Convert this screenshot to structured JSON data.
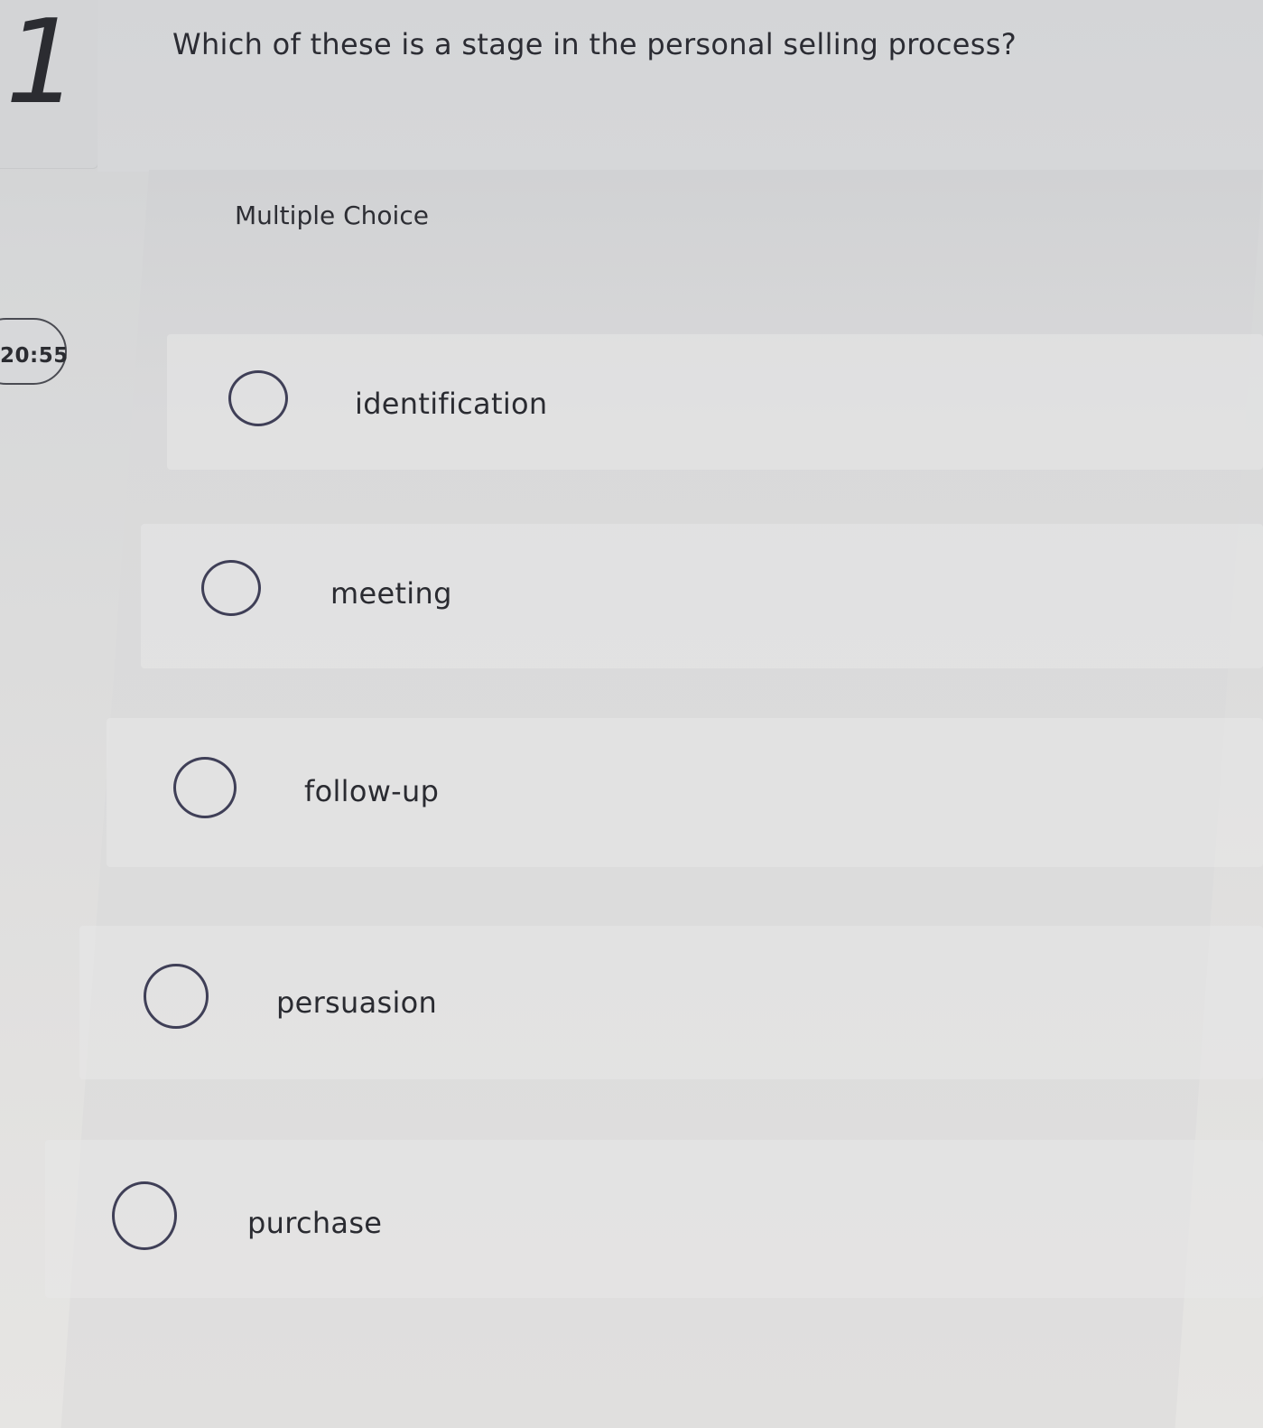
{
  "question": {
    "number": "1",
    "text": "Which of these is a stage in the personal selling process?",
    "type_label": "Multiple Choice"
  },
  "timer": {
    "value": "20:55"
  },
  "choices": [
    {
      "label": "identification",
      "selected": false
    },
    {
      "label": "meeting",
      "selected": false
    },
    {
      "label": "follow-up",
      "selected": false
    },
    {
      "label": "persuasion",
      "selected": false
    },
    {
      "label": "purchase",
      "selected": false
    }
  ]
}
